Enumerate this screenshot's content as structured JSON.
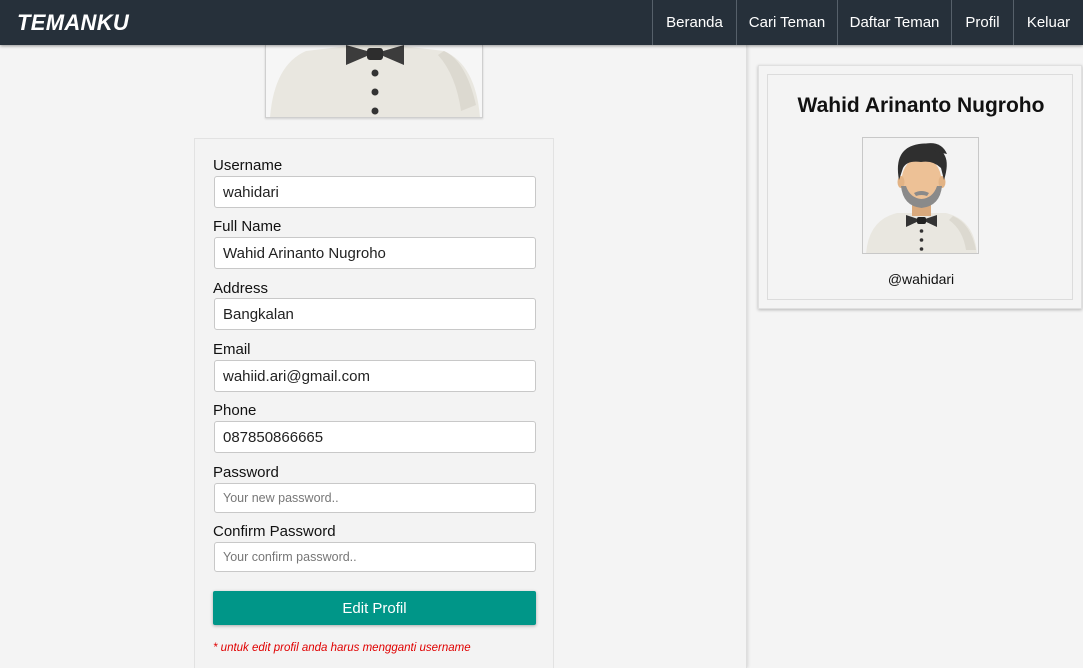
{
  "app": {
    "brand": "TEMANKU"
  },
  "nav": {
    "items": [
      {
        "label": "Beranda"
      },
      {
        "label": "Cari Teman"
      },
      {
        "label": "Daftar Teman"
      },
      {
        "label": "Profil"
      },
      {
        "label": "Keluar"
      }
    ]
  },
  "form": {
    "username": {
      "label": "Username",
      "value": "wahidari"
    },
    "fullname": {
      "label": "Full Name",
      "value": "Wahid Arinanto Nugroho"
    },
    "address": {
      "label": "Address",
      "value": "Bangkalan"
    },
    "email": {
      "label": "Email",
      "value": "wahiid.ari@gmail.com"
    },
    "phone": {
      "label": "Phone",
      "value": "087850866665"
    },
    "password": {
      "label": "Password",
      "value": "",
      "placeholder": "Your new password.."
    },
    "confirm_password": {
      "label": "Confirm Password",
      "value": "",
      "placeholder": "Your confirm password.."
    },
    "submit_label": "Edit Profil",
    "note": "* untuk edit profil anda harus mengganti username"
  },
  "profile": {
    "name": "Wahid Arinanto Nugroho",
    "username": "@wahidari"
  },
  "colors": {
    "navbar": "#26303a",
    "button": "#009688",
    "note": "#e00000"
  },
  "icons": {
    "avatar": "user-avatar-icon"
  }
}
